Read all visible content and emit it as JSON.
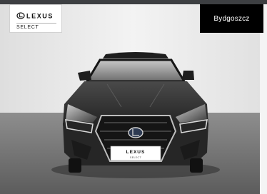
{
  "brand": {
    "wordmark": "LEXUS",
    "tier": "SELECT"
  },
  "dealer": {
    "city": "Bydgoszcz"
  },
  "photo": {
    "plate_wordmark": "LEXUS",
    "plate_tier": "SELECT"
  },
  "colors": {
    "car_body": "#2a2a2a",
    "studio_wall": "#e9e9e9",
    "studio_floor": "#7d7d7d",
    "badge_background": "#000000"
  }
}
